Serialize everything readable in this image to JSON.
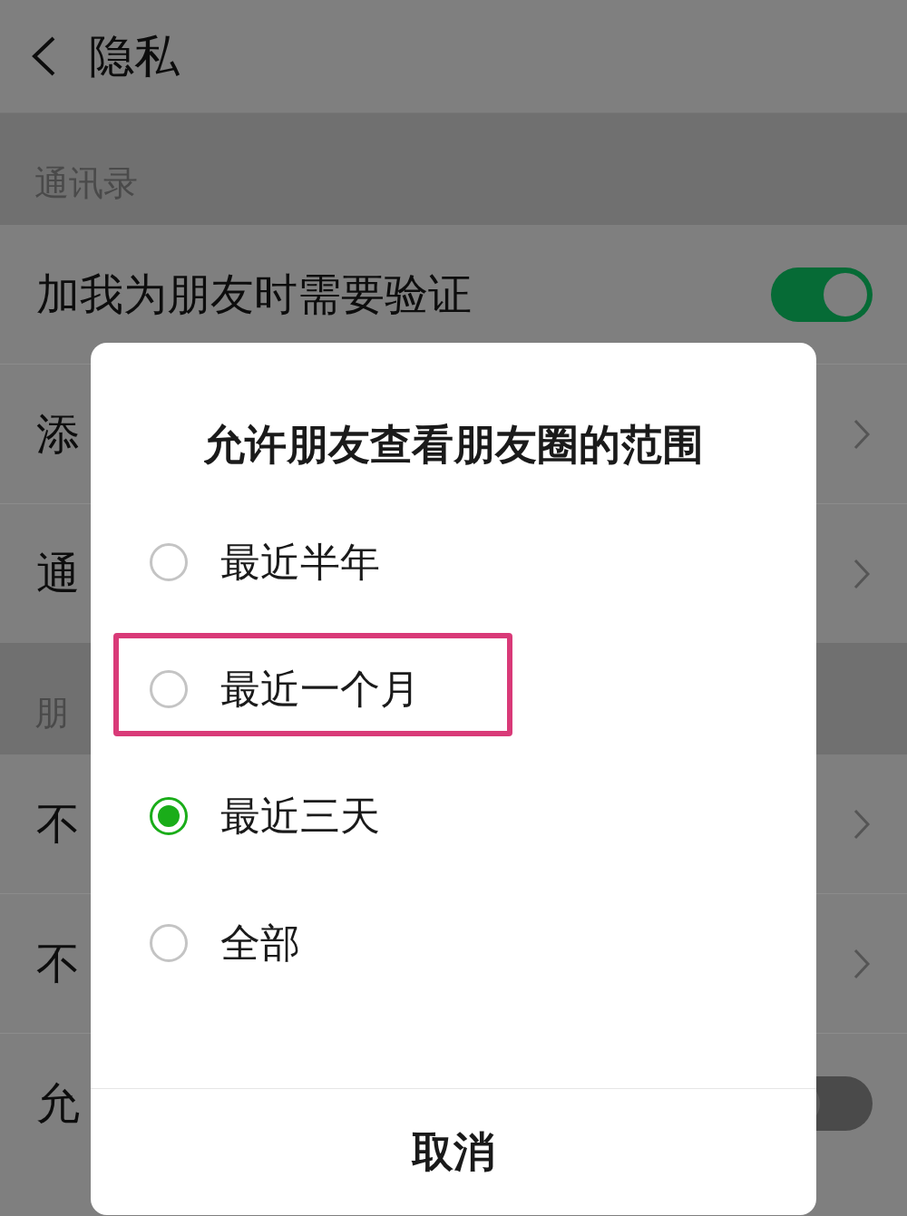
{
  "header": {
    "title": "隐私"
  },
  "sections": [
    {
      "title": "通讯录",
      "rows": [
        {
          "label": "加我为朋友时需要验证",
          "kind": "toggle",
          "on": true
        },
        {
          "label": "添",
          "kind": "link"
        },
        {
          "label": "通",
          "kind": "link"
        }
      ]
    },
    {
      "title": "朋",
      "rows": [
        {
          "label": "不",
          "kind": "link"
        },
        {
          "label": "不",
          "kind": "link"
        },
        {
          "label": "允",
          "kind": "toggle",
          "on": false
        }
      ]
    }
  ],
  "dialog": {
    "title": "允许朋友查看朋友圈的范围",
    "options": [
      {
        "label": "最近半年",
        "selected": false,
        "highlighted": false
      },
      {
        "label": "最近一个月",
        "selected": false,
        "highlighted": true
      },
      {
        "label": "最近三天",
        "selected": true,
        "highlighted": false
      },
      {
        "label": "全部",
        "selected": false,
        "highlighted": false
      }
    ],
    "cancel": "取消"
  }
}
